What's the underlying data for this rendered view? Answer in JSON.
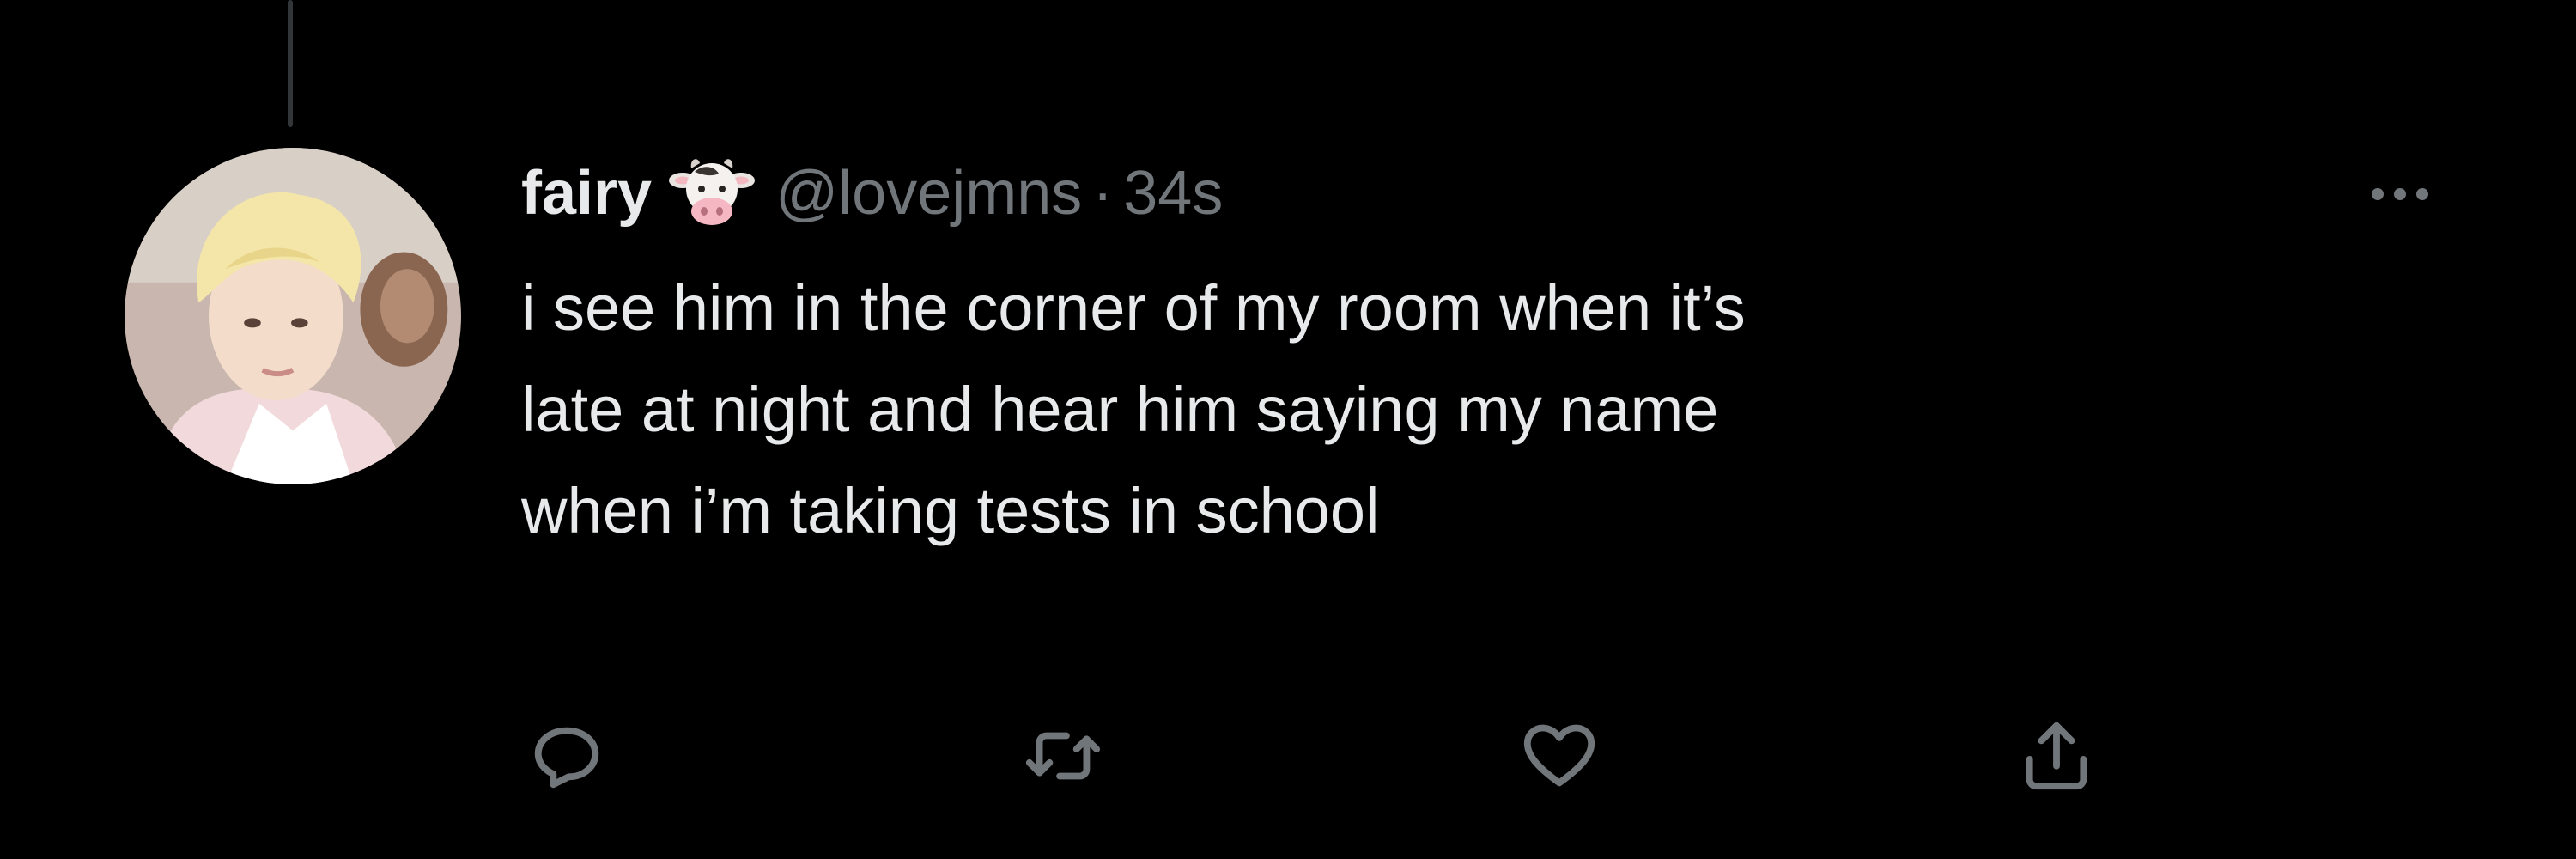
{
  "tweet": {
    "display_name": "fairy",
    "name_emoji": "cow-face-icon",
    "handle": "@lovejmns",
    "separator": "·",
    "timestamp": "34s",
    "text": "i see him in the corner of my room when it’s\nlate at night and hear him saying my name\nwhen i’m taking tests in school"
  },
  "actions": [
    {
      "icon": "reply-icon"
    },
    {
      "icon": "retweet-icon"
    },
    {
      "icon": "like-icon"
    },
    {
      "icon": "share-icon"
    }
  ],
  "colors": {
    "background": "#000000",
    "primary_text": "#e7e9ea",
    "secondary_text": "#71767b",
    "thread_line": "#333639"
  }
}
